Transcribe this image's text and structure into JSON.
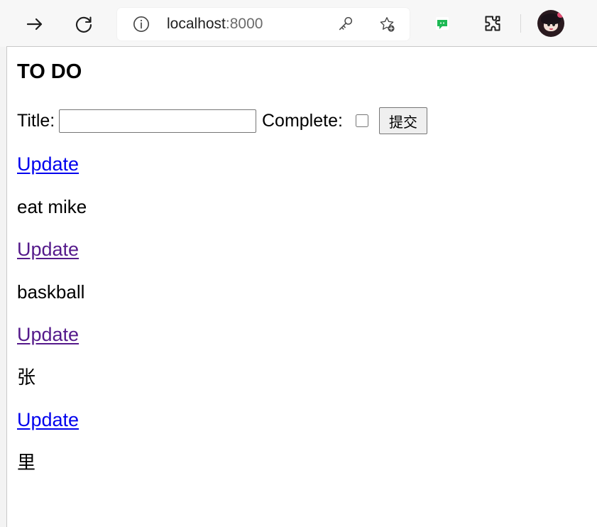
{
  "browser": {
    "url_host": "localhost",
    "url_port": ":8000",
    "icons": {
      "forward": "forward-arrow-icon",
      "refresh": "refresh-icon",
      "info": "info-icon",
      "password": "key-icon",
      "favorites": "star-add-icon",
      "extension": "green-extension-icon",
      "extensions": "puzzle-icon",
      "profile": "avatar"
    },
    "colors": {
      "toolbar_bg": "#f7f7f7",
      "address_bg": "#ffffff",
      "extension_green": "#1db954"
    }
  },
  "page": {
    "title": "TO DO",
    "form": {
      "title_label": "Title:",
      "title_value": "",
      "complete_label": "Complete:",
      "complete_checked": false,
      "submit_label": "提交"
    },
    "todos": [
      {
        "link_label": "Update",
        "title": "eat mike",
        "link_state": "unvisited"
      },
      {
        "link_label": "Update",
        "title": "baskball",
        "link_state": "visited"
      },
      {
        "link_label": "Update",
        "title": "张",
        "link_state": "visited"
      },
      {
        "link_label": "Update",
        "title": "里",
        "link_state": "unvisited"
      }
    ]
  },
  "colors": {
    "link_unvisited": "#0000ee",
    "link_visited": "#551a8b",
    "text": "#000000",
    "page_bg": "#ffffff"
  }
}
